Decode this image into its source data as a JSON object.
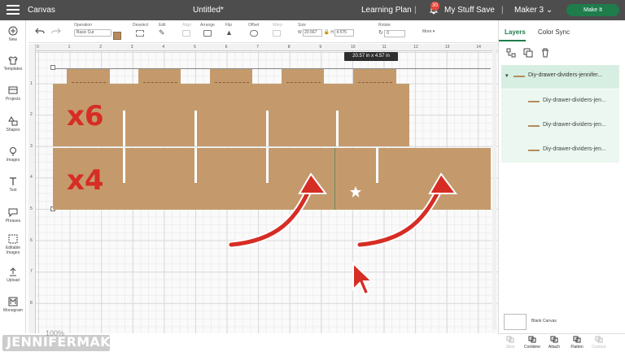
{
  "header": {
    "app_title": "Canvas",
    "doc_title": "Untitled*",
    "learning_plan": "Learning Plan",
    "separator": "|",
    "notifications_count": "30",
    "my_stuff": "My Stuff",
    "save": "Save",
    "machine": "Maker 3",
    "make_it": "Make It"
  },
  "toolbar": {
    "undo_icon": "undo-icon",
    "redo_icon": "redo-icon",
    "operation_label": "Operation",
    "operation_value": "Basic Cut",
    "deselect": "Deselect",
    "edit": "Edit",
    "align": "Align",
    "arrange": "Arrange",
    "flip": "Flip",
    "offset": "Offset",
    "warp": "Warp",
    "size_label": "Size",
    "w_label": "W",
    "w_value": "20.567",
    "h_label": "H",
    "h_value": "4.575",
    "rotate_label": "Rotate",
    "rotate_value": "0",
    "more": "More"
  },
  "leftnav": [
    {
      "label": "New",
      "icon": "plus-icon"
    },
    {
      "label": "Templates",
      "icon": "shirt-icon"
    },
    {
      "label": "Projects",
      "icon": "projects-icon"
    },
    {
      "label": "Shapes",
      "icon": "shapes-icon"
    },
    {
      "label": "Images",
      "icon": "bulb-icon"
    },
    {
      "label": "Text",
      "icon": "text-icon"
    },
    {
      "label": "Phrases",
      "icon": "phrases-icon"
    },
    {
      "label": "Editable Images",
      "icon": "editable-images-icon"
    },
    {
      "label": "Upload",
      "icon": "upload-icon"
    },
    {
      "label": "Monogram",
      "icon": "monogram-icon"
    }
  ],
  "ruler": {
    "top": [
      "0",
      "1",
      "2",
      "3",
      "4",
      "5",
      "6",
      "7",
      "8",
      "9",
      "10",
      "11",
      "12",
      "13",
      "14"
    ],
    "left": [
      "1",
      "2",
      "3",
      "4",
      "5",
      "6",
      "7",
      "8"
    ]
  },
  "canvas": {
    "tooltip": "20.57  in x 4.57  in",
    "label_top": "x6",
    "label_bottom": "x4",
    "zoom": "100%"
  },
  "panel": {
    "tab_layers": "Layers",
    "tab_color_sync": "Color Sync",
    "group_name": "Diy-drawer-dividers-jennifer...",
    "children": [
      "Diy-drawer-dividers-jen...",
      "Diy-drawer-dividers-jen...",
      "Diy-drawer-dividers-jen..."
    ],
    "blank_canvas": "Blank Canvas",
    "actions": [
      {
        "label": "Slice",
        "enabled": false
      },
      {
        "label": "Combine",
        "enabled": true
      },
      {
        "label": "Attach",
        "enabled": true
      },
      {
        "label": "Flatten",
        "enabled": true
      },
      {
        "label": "Contour",
        "enabled": false
      }
    ]
  },
  "brand": "JENNIFERMAKER",
  "colors": {
    "accent": "#1e7d4b",
    "cardboard": "#c49a6c",
    "arrow": "#d62d24",
    "header": "#4d4d4d"
  }
}
